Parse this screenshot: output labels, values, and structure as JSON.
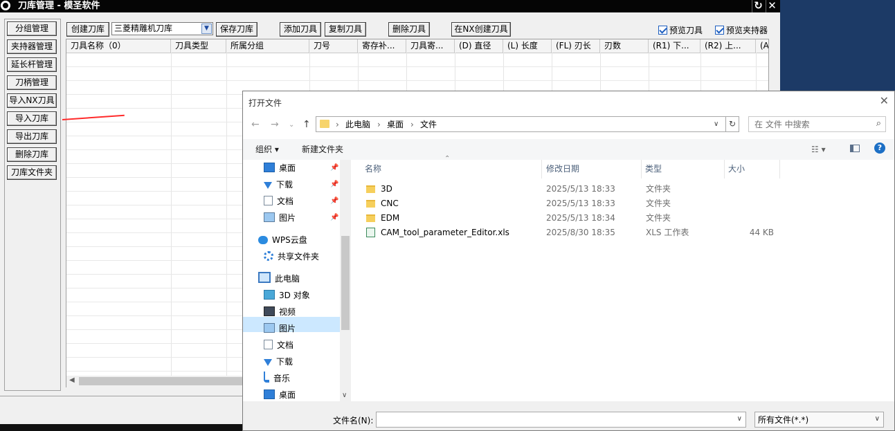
{
  "main": {
    "title": "刀库管理 - 模圣软件",
    "side_buttons": [
      "分组管理",
      "夹持器管理",
      "延长杆管理",
      "刀柄管理",
      "导入NX刀具",
      "导入刀库",
      "导出刀库",
      "删除刀库",
      "刀库文件夹"
    ],
    "toolbar": {
      "create_library": "创建刀库",
      "library_select": "三菱精雕机刀库",
      "save_library": "保存刀库",
      "add_tool": "添加刀具",
      "copy_tool": "复制刀具",
      "delete_tool": "删除刀具",
      "create_in_nx": "在NX创建刀具",
      "preview_tool": "预览刀具",
      "preview_holder": "预览夹持器"
    },
    "grid_columns": [
      "刀具名称（0）",
      "刀具类型",
      "所属分组",
      "刀号",
      "寄存补...",
      "刀具寄...",
      "(D) 直径",
      "(L) 长度",
      "(FL) 刃长",
      "刃数",
      "(R1) 下...",
      "(R2) 上...",
      "(A)"
    ]
  },
  "dialog": {
    "title": "打开文件",
    "breadcrumb": [
      "此电脑",
      "桌面",
      "文件"
    ],
    "search_placeholder": "在 文件 中搜索",
    "organize": "组织 ▾",
    "new_folder": "新建文件夹",
    "nav_items": [
      {
        "label": "桌面",
        "icon": "desktop-icon",
        "pinned": true
      },
      {
        "label": "下载",
        "icon": "download-icon",
        "pinned": true
      },
      {
        "label": "文档",
        "icon": "document-icon",
        "pinned": true
      },
      {
        "label": "图片",
        "icon": "picture-icon",
        "pinned": true
      },
      {
        "label": "WPS云盘",
        "icon": "cloud-icon",
        "pinned": false
      },
      {
        "label": "共享文件夹",
        "icon": "share-icon",
        "pinned": false
      },
      {
        "label": "此电脑",
        "icon": "computer-icon",
        "pinned": false
      },
      {
        "label": "3D 对象",
        "icon": "cube-icon",
        "pinned": false
      },
      {
        "label": "视频",
        "icon": "video-icon",
        "pinned": false
      },
      {
        "label": "图片",
        "icon": "picture-icon",
        "pinned": false
      },
      {
        "label": "文档",
        "icon": "document-icon",
        "pinned": false
      },
      {
        "label": "下载",
        "icon": "download-icon",
        "pinned": false
      },
      {
        "label": "音乐",
        "icon": "music-icon",
        "pinned": false
      },
      {
        "label": "桌面",
        "icon": "desktop-icon",
        "pinned": false
      }
    ],
    "columns": {
      "name": "名称",
      "modified": "修改日期",
      "type": "类型",
      "size": "大小"
    },
    "files": [
      {
        "name": "3D",
        "modified": "2025/5/13 18:33",
        "type": "文件夹",
        "size": "",
        "kind": "folder"
      },
      {
        "name": "CNC",
        "modified": "2025/5/13 18:33",
        "type": "文件夹",
        "size": "",
        "kind": "folder"
      },
      {
        "name": "EDM",
        "modified": "2025/5/13 18:34",
        "type": "文件夹",
        "size": "",
        "kind": "folder"
      },
      {
        "name": "CAM_tool_parameter_Editor.xls",
        "modified": "2025/8/30 18:35",
        "type": "XLS 工作表",
        "size": "44 KB",
        "kind": "xls"
      }
    ],
    "filename_label": "文件名(N):",
    "filename_value": "",
    "filetype": "所有文件(*.*)"
  }
}
